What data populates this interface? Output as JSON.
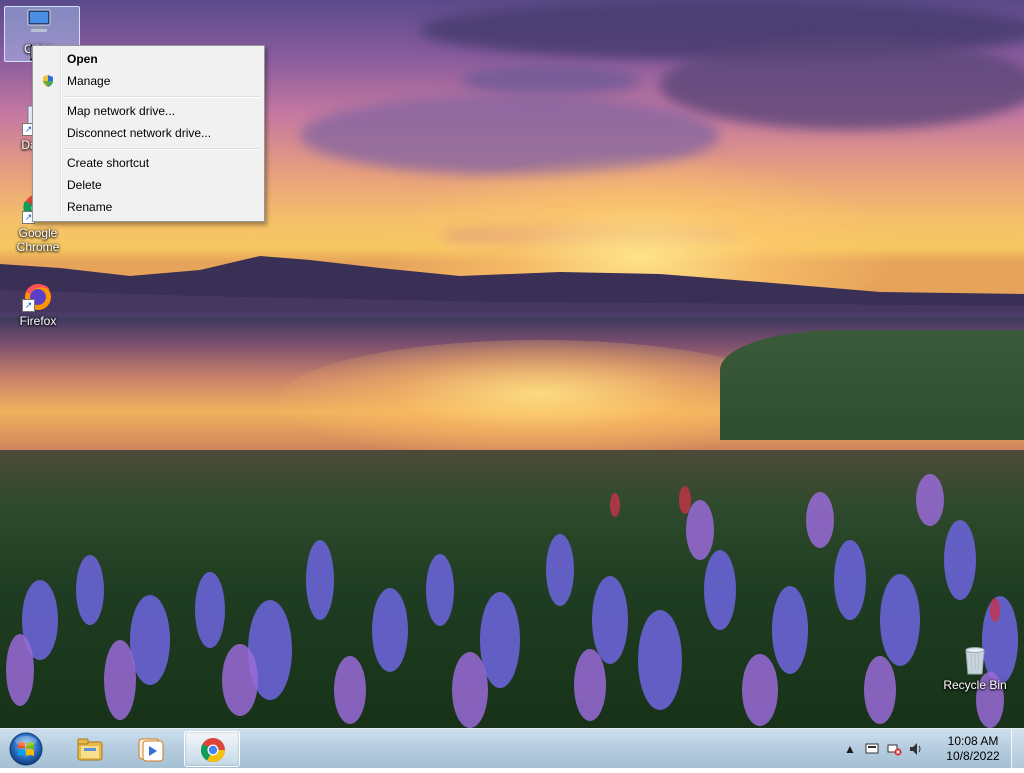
{
  "desktop": {
    "icons": [
      {
        "label": "COM"
      },
      {
        "label": "DataV"
      },
      {
        "label": "Google Chrome"
      },
      {
        "label": "Firefox"
      },
      {
        "label": "Recycle Bin"
      }
    ]
  },
  "context_menu": {
    "items": [
      {
        "label": "Open",
        "bold": true
      },
      {
        "label": "Manage",
        "icon": "shield-icon"
      },
      {
        "label": "Map network drive..."
      },
      {
        "label": "Disconnect network drive..."
      },
      {
        "label": "Create shortcut"
      },
      {
        "label": "Delete"
      },
      {
        "label": "Rename"
      }
    ]
  },
  "taskbar": {
    "pinned": [
      {
        "name": "file-explorer-icon"
      },
      {
        "name": "media-player-icon"
      },
      {
        "name": "chrome-icon",
        "active": true
      }
    ],
    "tray": {
      "time": "10:08 AM",
      "date": "10/8/2022"
    }
  },
  "colors": {
    "menu_bg": "#f1f1f1",
    "taskbar": "#b4cbe0",
    "selection": "#b4d2ff"
  }
}
